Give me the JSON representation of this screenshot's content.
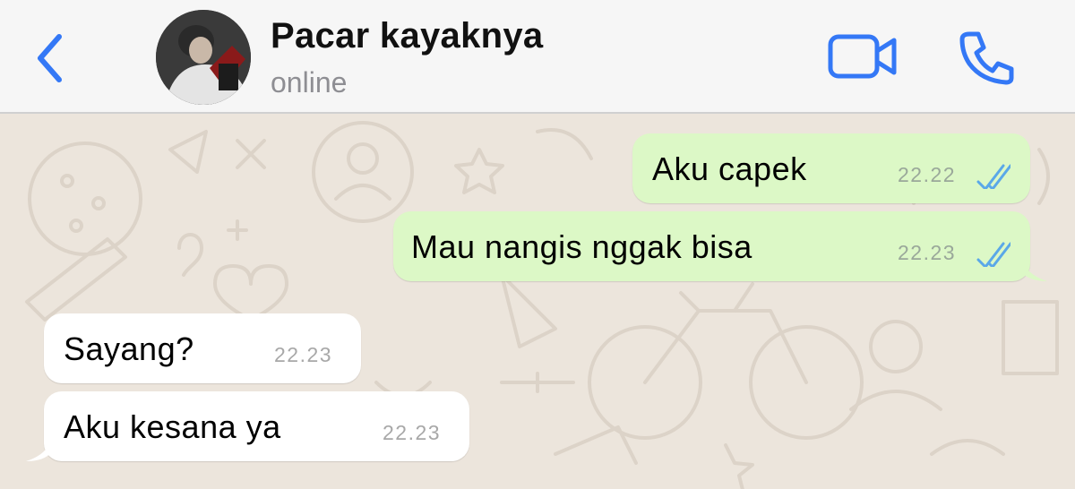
{
  "header": {
    "contact_name": "Pacar kayaknya",
    "status": "online",
    "back_icon": "chevron-left-icon",
    "video_icon": "video-camera-icon",
    "call_icon": "phone-icon"
  },
  "colors": {
    "accent": "#3478f6",
    "outgoing_bubble": "#dcf8c6",
    "incoming_bubble": "#ffffff",
    "wallpaper": "#ece5dc",
    "read_ticks": "#5aa8e8"
  },
  "messages": [
    {
      "direction": "out",
      "text": "Aku capek",
      "time": "22.22",
      "read": true
    },
    {
      "direction": "out",
      "text": "Mau nangis nggak bisa",
      "time": "22.23",
      "read": true
    },
    {
      "direction": "in",
      "text": "Sayang?",
      "time": "22.23"
    },
    {
      "direction": "in",
      "text": "Aku kesana ya",
      "time": "22.23"
    }
  ]
}
